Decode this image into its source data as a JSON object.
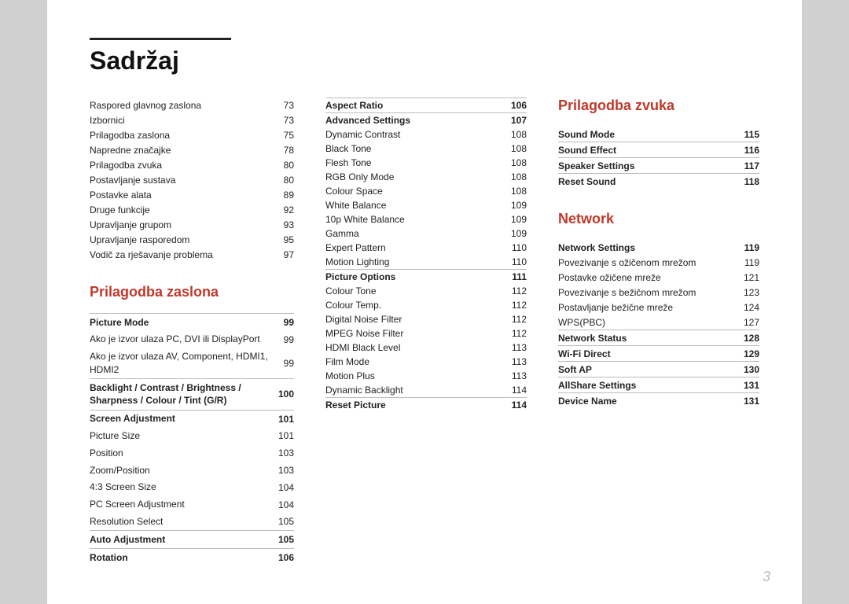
{
  "title": "Sadržaj",
  "page_number": "3",
  "left_col": {
    "intro_items": [
      {
        "label": "Raspored glavnog zaslona",
        "page": "73"
      },
      {
        "label": "Izbornici",
        "page": "73"
      },
      {
        "label": "Prilagodba zaslona",
        "page": "75"
      },
      {
        "label": "Napredne značajke",
        "page": "78"
      },
      {
        "label": "Prilagodba zvuka",
        "page": "80"
      },
      {
        "label": "Postavljanje sustava",
        "page": "80"
      },
      {
        "label": "Postavke alata",
        "page": "89"
      },
      {
        "label": "Druge funkcije",
        "page": "92"
      },
      {
        "label": "Upravljanje grupom",
        "page": "93"
      },
      {
        "label": "Upravljanje rasporedom",
        "page": "95"
      },
      {
        "label": "Vodič za rješavanje problema",
        "page": "97"
      }
    ],
    "section1": {
      "heading": "Prilagodba zaslona",
      "items": [
        {
          "label": "Picture Mode",
          "page": "99",
          "bold": true,
          "sep": true
        },
        {
          "label": "Ako je izvor ulaza PC, DVI ili DisplayPort",
          "page": "99"
        },
        {
          "label": "Ako je izvor ulaza AV, Component, HDMI1, HDMI2",
          "page": "99"
        },
        {
          "label": "Backlight / Contrast / Brightness / Sharpness / Colour / Tint (G/R)",
          "page": "100",
          "bold": true,
          "sep": true
        },
        {
          "label": "Screen Adjustment",
          "page": "101",
          "bold": true,
          "sep": true
        },
        {
          "label": "Picture Size",
          "page": "101"
        },
        {
          "label": "Position",
          "page": "103"
        },
        {
          "label": "Zoom/Position",
          "page": "103"
        },
        {
          "label": "4:3 Screen Size",
          "page": "104"
        },
        {
          "label": "PC Screen Adjustment",
          "page": "104"
        },
        {
          "label": "Resolution Select",
          "page": "105"
        },
        {
          "label": "Auto Adjustment",
          "page": "105",
          "bold": true,
          "sep": true
        },
        {
          "label": "Rotation",
          "page": "106",
          "bold": true,
          "sep": true
        }
      ]
    }
  },
  "mid_col": {
    "items": [
      {
        "label": "Aspect Ratio",
        "page": "106",
        "bold": true,
        "sep": true
      },
      {
        "label": "Advanced Settings",
        "page": "107",
        "bold": true,
        "sep": true
      },
      {
        "label": "Dynamic Contrast",
        "page": "108"
      },
      {
        "label": "Black Tone",
        "page": "108"
      },
      {
        "label": "Flesh Tone",
        "page": "108"
      },
      {
        "label": "RGB Only Mode",
        "page": "108"
      },
      {
        "label": "Colour Space",
        "page": "108"
      },
      {
        "label": "White Balance",
        "page": "109"
      },
      {
        "label": "10p White Balance",
        "page": "109"
      },
      {
        "label": "Gamma",
        "page": "109"
      },
      {
        "label": "Expert Pattern",
        "page": "110"
      },
      {
        "label": "Motion Lighting",
        "page": "110"
      },
      {
        "label": "Picture Options",
        "page": "111",
        "bold": true,
        "sep": true
      },
      {
        "label": "Colour Tone",
        "page": "112"
      },
      {
        "label": "Colour Temp.",
        "page": "112"
      },
      {
        "label": "Digital Noise Filter",
        "page": "112"
      },
      {
        "label": "MPEG Noise Filter",
        "page": "112"
      },
      {
        "label": "HDMI Black Level",
        "page": "113"
      },
      {
        "label": "Film Mode",
        "page": "113"
      },
      {
        "label": "Motion Plus",
        "page": "113"
      },
      {
        "label": "Dynamic Backlight",
        "page": "114"
      },
      {
        "label": "Reset Picture",
        "page": "114",
        "bold": true,
        "sep": true
      }
    ]
  },
  "right_col": {
    "section1": {
      "heading": "Prilagodba zvuka",
      "items": [
        {
          "label": "Sound Mode",
          "page": "115",
          "bold": true
        },
        {
          "label": "Sound Effect",
          "page": "116",
          "bold": true
        },
        {
          "label": "Speaker Settings",
          "page": "117",
          "bold": true
        },
        {
          "label": "Reset Sound",
          "page": "118",
          "bold": true
        }
      ]
    },
    "section2": {
      "heading": "Network",
      "items": [
        {
          "label": "Network Settings",
          "page": "119",
          "bold": true
        },
        {
          "label": "Povezivanje s ožičenom mrežom",
          "page": "119"
        },
        {
          "label": "Postavke ožičene mreže",
          "page": "121"
        },
        {
          "label": "Povezivanje s bežičnom mrežom",
          "page": "123"
        },
        {
          "label": "Postavljanje bežične mreže",
          "page": "124"
        },
        {
          "label": "WPS(PBC)",
          "page": "127"
        },
        {
          "label": "Network Status",
          "page": "128",
          "bold": true
        },
        {
          "label": "Wi-Fi Direct",
          "page": "129",
          "bold": true
        },
        {
          "label": "Soft AP",
          "page": "130",
          "bold": true
        },
        {
          "label": "AllShare Settings",
          "page": "131",
          "bold": true
        },
        {
          "label": "Device Name",
          "page": "131",
          "bold": true
        }
      ]
    }
  }
}
